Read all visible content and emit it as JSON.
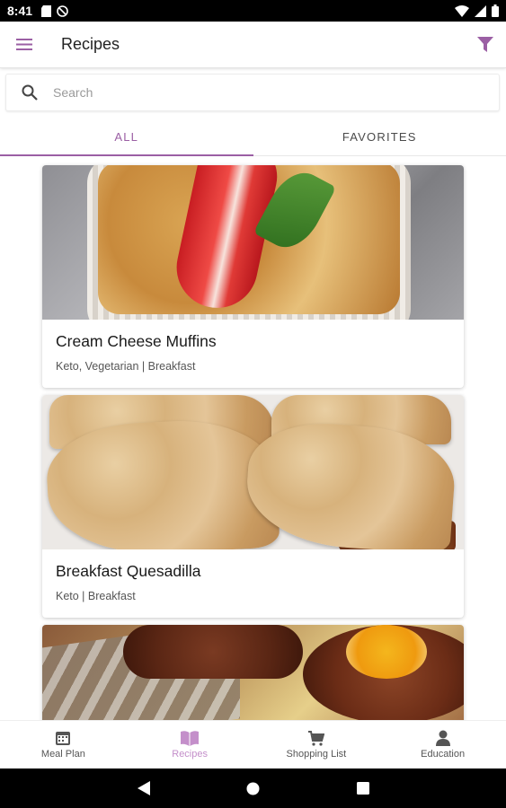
{
  "status_bar": {
    "time": "8:41"
  },
  "app_bar": {
    "title": "Recipes"
  },
  "search": {
    "placeholder": "Search"
  },
  "tabs": [
    {
      "label": "ALL",
      "active": true
    },
    {
      "label": "FAVORITES",
      "active": false
    }
  ],
  "recipes": [
    {
      "name": "Cream Cheese Muffins",
      "tags": "Keto, Vegetarian | Breakfast",
      "image": "muffin-photo"
    },
    {
      "name": "Breakfast Quesadilla",
      "tags": "Keto | Breakfast",
      "image": "quesadilla-photo"
    },
    {
      "name": "",
      "tags": "",
      "image": "steak-egg-photo"
    }
  ],
  "bottom_nav": [
    {
      "label": "Meal Plan",
      "icon": "calendar-icon",
      "active": false
    },
    {
      "label": "Recipes",
      "icon": "book-icon",
      "active": true
    },
    {
      "label": "Shopping List",
      "icon": "cart-icon",
      "active": false
    },
    {
      "label": "Education",
      "icon": "person-icon",
      "active": false
    }
  ],
  "colors": {
    "accent": "#9b5fa4",
    "nav_active": "#c48fca"
  }
}
